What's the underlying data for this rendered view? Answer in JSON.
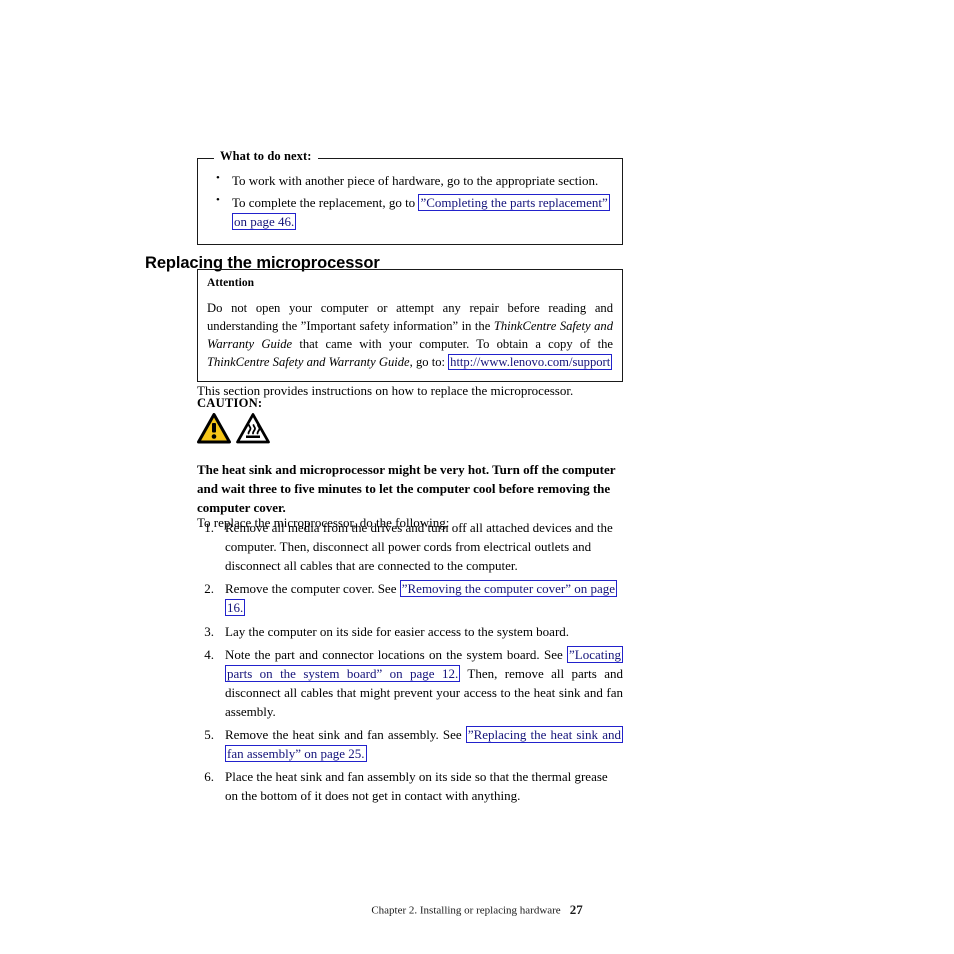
{
  "what_to_do_next": {
    "legend": "What to do next:",
    "bullets": [
      {
        "text_before": "To work with another piece of hardware, go to the appropriate section.",
        "link": "",
        "text_after": ""
      },
      {
        "text_before": "To complete the replacement, go to ",
        "link": "”Completing the parts replacement” on page 46.",
        "text_after": ""
      }
    ]
  },
  "section": {
    "heading": "Replacing the microprocessor"
  },
  "attention": {
    "title": "Attention",
    "line1_a": "Do not open your computer or attempt any repair before reading and understanding the ”Important safety information” in the ",
    "italic1": "ThinkCentre Safety and Warranty Guide",
    "line1_b": " that came with your computer. To obtain a copy of the ",
    "italic2": "ThinkCentre Safety and Warranty Guide",
    "line1_c": ", go to: ",
    "url": "http://www.lenovo.com/support"
  },
  "intro": {
    "text": "This section provides instructions on how to replace the microprocessor."
  },
  "caution": {
    "label": "CAUTION:",
    "icon_warning": "warning-triangle-icon",
    "icon_hot": "hot-surface-icon",
    "text": "The heat sink and microprocessor might be very hot. Turn off the computer and wait three to five minutes to let the computer cool before removing the computer cover.",
    "warning_color": "#f5c518"
  },
  "procedure": {
    "lead_in": "To replace the microprocessor, do the following:",
    "steps": [
      {
        "text_before": "Remove all media from the drives and turn off all attached devices and the computer. Then, disconnect all power cords from electrical outlets and disconnect all cables that are connected to the computer.",
        "link": "",
        "text_after": ""
      },
      {
        "text_before": "Remove the computer cover. See ",
        "link": "”Removing the computer cover” on page 16.",
        "text_after": ""
      },
      {
        "text_before": "Lay the computer on its side for easier access to the system board.",
        "link": "",
        "text_after": ""
      },
      {
        "text_before": "Note the part and connector locations on the system board. See ",
        "link": "”Locating parts on the system board” on page 12.",
        "text_after": " Then, remove all parts and disconnect all cables that might prevent your access to the heat sink and fan assembly."
      },
      {
        "text_before": "Remove the heat sink and fan assembly. See ",
        "link": "”Replacing the heat sink and fan assembly” on page 25.",
        "text_after": ""
      },
      {
        "text_before": "Place the heat sink and fan assembly on its side so that the thermal grease on the bottom of it does not get in contact with anything.",
        "link": "",
        "text_after": ""
      }
    ]
  },
  "footer": {
    "chapter": "Chapter 2. Installing or replacing hardware",
    "page_number": "27"
  }
}
